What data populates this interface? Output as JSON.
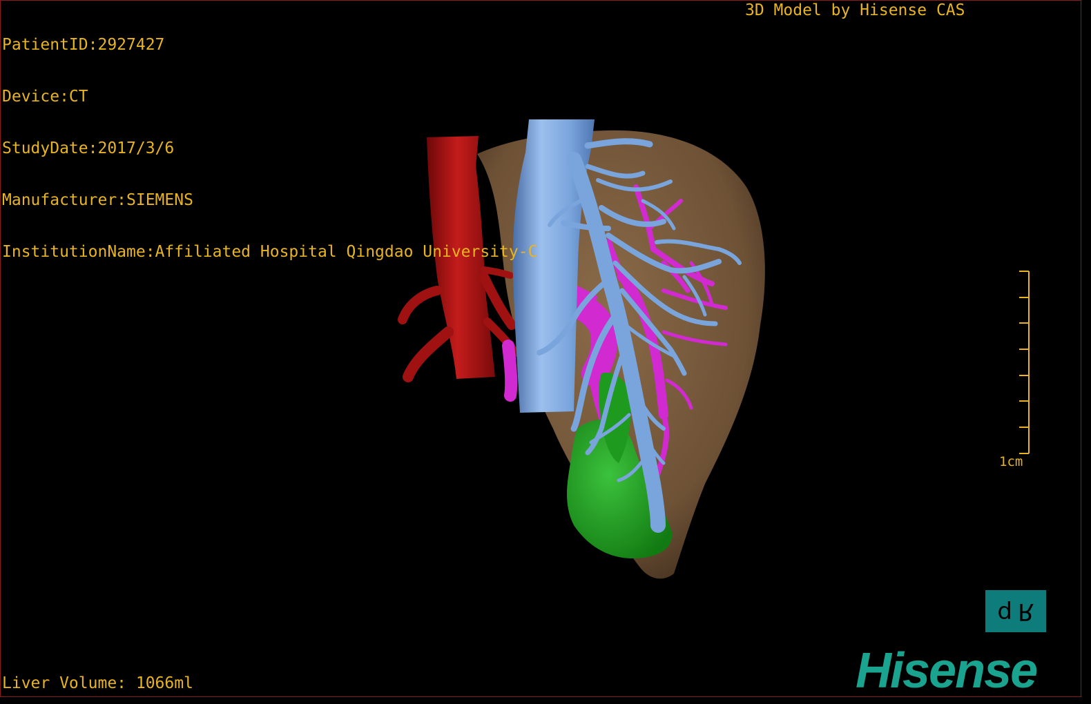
{
  "patient_info": {
    "patient_id": "PatientID:2927427",
    "device": "Device:CT",
    "study_date": "StudyDate:2017/3/6",
    "manufacturer": "Manufacturer:SIEMENS",
    "institution": "InstitutionName:Affiliated Hospital Qingdao University-C"
  },
  "credit": "3D Model by Hisense CAS",
  "liver_volume": "Liver Volume: 1066ml",
  "scale_bar": {
    "label": "1cm"
  },
  "orientation": {
    "left_glyph": "d",
    "right_glyph": "R"
  },
  "brand": "Hisense",
  "colors": {
    "border": "#8b1a1a",
    "text": "#e8b422",
    "liver": "#7a5a3a",
    "artery": "#b01414",
    "vena_cava": "#7aa4dc",
    "portal_vein": "#d02ad0",
    "tumor": "#1e9a1e",
    "brand": "#1aa38f",
    "orientation_bg": "#0f7c7c"
  }
}
